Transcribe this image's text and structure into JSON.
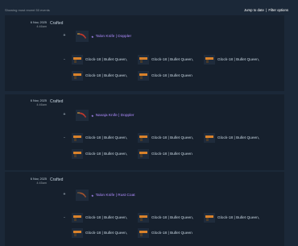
{
  "header": {
    "showing": "Showing most recent 50 events",
    "jump": "Jump to date",
    "sep": "|",
    "filter": "Filter options"
  },
  "events": [
    {
      "date": "6 Nov, 2025",
      "time": "4:46am",
      "action": "Crafted",
      "plus": "+",
      "minus": "-",
      "gained": "Talon Knife | Doppler",
      "lost": [
        "Glock-18 | Bullet Queen,",
        "Glock-18 | Bullet Queen,",
        "Glock-18 | Bullet Queen,",
        "Glock-18 | Bullet Queen,",
        "Glock-18 | Bullet Queen"
      ]
    },
    {
      "date": "6 Nov, 2025",
      "time": "4:46am",
      "action": "Crafted",
      "plus": "+",
      "minus": "-",
      "gained": "Navaja Knife | Doppler",
      "lost": [
        "Glock-18 | Bullet Queen,",
        "Glock-18 | Bullet Queen,",
        "Glock-18 | Bullet Queen,",
        "Glock-18 | Bullet Queen,",
        "Glock-18 | Bullet Queen"
      ]
    },
    {
      "date": "6 Nov, 2025",
      "time": "4:45am",
      "action": "Crafted",
      "plus": "+",
      "minus": "-",
      "gained": "Talon Knife | Rust Coat",
      "lost": [
        "Glock-18 | Bullet Queen,",
        "Glock-18 | Bullet Queen,",
        "Glock-18 | Bullet Queen,",
        "Glock-18 | Bullet Queen,",
        "Glock-18 | Bullet Queen"
      ]
    }
  ],
  "colors": {
    "background": "#1b2838",
    "row": "#16202d",
    "covert": "#b08cff"
  },
  "icons": {
    "knife": "knife-icon",
    "gun": "glock-icon",
    "star": "star-icon"
  }
}
